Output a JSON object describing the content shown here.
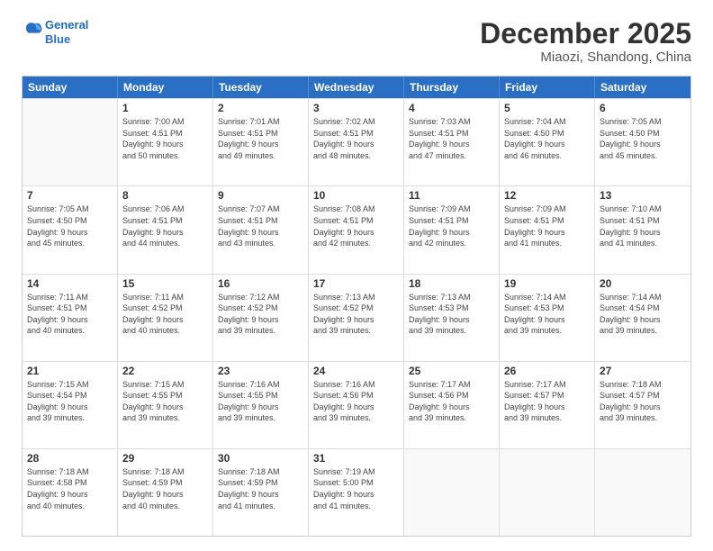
{
  "header": {
    "logo_line1": "General",
    "logo_line2": "Blue",
    "title": "December 2025",
    "subtitle": "Miaozi, Shandong, China"
  },
  "days_of_week": [
    "Sunday",
    "Monday",
    "Tuesday",
    "Wednesday",
    "Thursday",
    "Friday",
    "Saturday"
  ],
  "weeks": [
    [
      {
        "day": "",
        "info": ""
      },
      {
        "day": "1",
        "info": "Sunrise: 7:00 AM\nSunset: 4:51 PM\nDaylight: 9 hours\nand 50 minutes."
      },
      {
        "day": "2",
        "info": "Sunrise: 7:01 AM\nSunset: 4:51 PM\nDaylight: 9 hours\nand 49 minutes."
      },
      {
        "day": "3",
        "info": "Sunrise: 7:02 AM\nSunset: 4:51 PM\nDaylight: 9 hours\nand 48 minutes."
      },
      {
        "day": "4",
        "info": "Sunrise: 7:03 AM\nSunset: 4:51 PM\nDaylight: 9 hours\nand 47 minutes."
      },
      {
        "day": "5",
        "info": "Sunrise: 7:04 AM\nSunset: 4:50 PM\nDaylight: 9 hours\nand 46 minutes."
      },
      {
        "day": "6",
        "info": "Sunrise: 7:05 AM\nSunset: 4:50 PM\nDaylight: 9 hours\nand 45 minutes."
      }
    ],
    [
      {
        "day": "7",
        "info": "Sunrise: 7:05 AM\nSunset: 4:50 PM\nDaylight: 9 hours\nand 45 minutes."
      },
      {
        "day": "8",
        "info": "Sunrise: 7:06 AM\nSunset: 4:51 PM\nDaylight: 9 hours\nand 44 minutes."
      },
      {
        "day": "9",
        "info": "Sunrise: 7:07 AM\nSunset: 4:51 PM\nDaylight: 9 hours\nand 43 minutes."
      },
      {
        "day": "10",
        "info": "Sunrise: 7:08 AM\nSunset: 4:51 PM\nDaylight: 9 hours\nand 42 minutes."
      },
      {
        "day": "11",
        "info": "Sunrise: 7:09 AM\nSunset: 4:51 PM\nDaylight: 9 hours\nand 42 minutes."
      },
      {
        "day": "12",
        "info": "Sunrise: 7:09 AM\nSunset: 4:51 PM\nDaylight: 9 hours\nand 41 minutes."
      },
      {
        "day": "13",
        "info": "Sunrise: 7:10 AM\nSunset: 4:51 PM\nDaylight: 9 hours\nand 41 minutes."
      }
    ],
    [
      {
        "day": "14",
        "info": "Sunrise: 7:11 AM\nSunset: 4:51 PM\nDaylight: 9 hours\nand 40 minutes."
      },
      {
        "day": "15",
        "info": "Sunrise: 7:11 AM\nSunset: 4:52 PM\nDaylight: 9 hours\nand 40 minutes."
      },
      {
        "day": "16",
        "info": "Sunrise: 7:12 AM\nSunset: 4:52 PM\nDaylight: 9 hours\nand 39 minutes."
      },
      {
        "day": "17",
        "info": "Sunrise: 7:13 AM\nSunset: 4:52 PM\nDaylight: 9 hours\nand 39 minutes."
      },
      {
        "day": "18",
        "info": "Sunrise: 7:13 AM\nSunset: 4:53 PM\nDaylight: 9 hours\nand 39 minutes."
      },
      {
        "day": "19",
        "info": "Sunrise: 7:14 AM\nSunset: 4:53 PM\nDaylight: 9 hours\nand 39 minutes."
      },
      {
        "day": "20",
        "info": "Sunrise: 7:14 AM\nSunset: 4:54 PM\nDaylight: 9 hours\nand 39 minutes."
      }
    ],
    [
      {
        "day": "21",
        "info": "Sunrise: 7:15 AM\nSunset: 4:54 PM\nDaylight: 9 hours\nand 39 minutes."
      },
      {
        "day": "22",
        "info": "Sunrise: 7:15 AM\nSunset: 4:55 PM\nDaylight: 9 hours\nand 39 minutes."
      },
      {
        "day": "23",
        "info": "Sunrise: 7:16 AM\nSunset: 4:55 PM\nDaylight: 9 hours\nand 39 minutes."
      },
      {
        "day": "24",
        "info": "Sunrise: 7:16 AM\nSunset: 4:56 PM\nDaylight: 9 hours\nand 39 minutes."
      },
      {
        "day": "25",
        "info": "Sunrise: 7:17 AM\nSunset: 4:56 PM\nDaylight: 9 hours\nand 39 minutes."
      },
      {
        "day": "26",
        "info": "Sunrise: 7:17 AM\nSunset: 4:57 PM\nDaylight: 9 hours\nand 39 minutes."
      },
      {
        "day": "27",
        "info": "Sunrise: 7:18 AM\nSunset: 4:57 PM\nDaylight: 9 hours\nand 39 minutes."
      }
    ],
    [
      {
        "day": "28",
        "info": "Sunrise: 7:18 AM\nSunset: 4:58 PM\nDaylight: 9 hours\nand 40 minutes."
      },
      {
        "day": "29",
        "info": "Sunrise: 7:18 AM\nSunset: 4:59 PM\nDaylight: 9 hours\nand 40 minutes."
      },
      {
        "day": "30",
        "info": "Sunrise: 7:18 AM\nSunset: 4:59 PM\nDaylight: 9 hours\nand 41 minutes."
      },
      {
        "day": "31",
        "info": "Sunrise: 7:19 AM\nSunset: 5:00 PM\nDaylight: 9 hours\nand 41 minutes."
      },
      {
        "day": "",
        "info": ""
      },
      {
        "day": "",
        "info": ""
      },
      {
        "day": "",
        "info": ""
      }
    ]
  ]
}
